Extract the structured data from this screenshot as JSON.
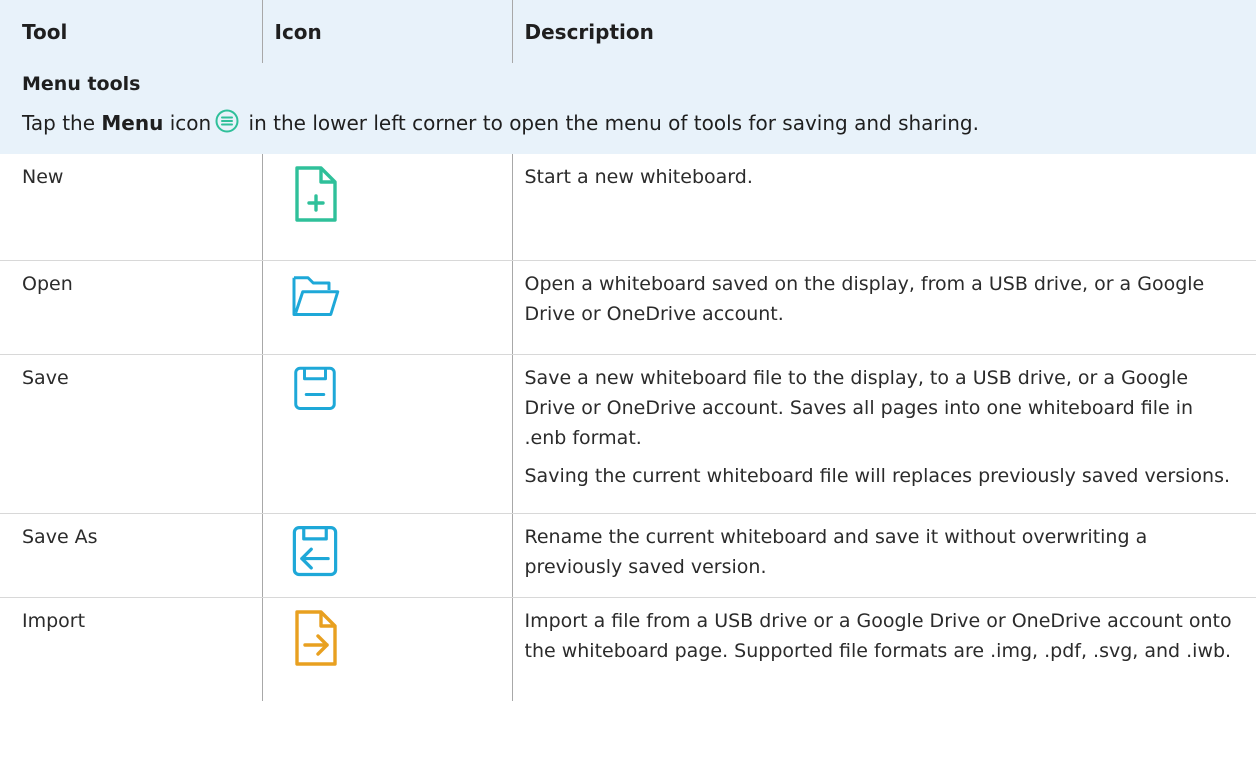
{
  "table": {
    "headers": {
      "tool": "Tool",
      "icon": "Icon",
      "description": "Description"
    },
    "section": {
      "title": "Menu tools",
      "intro_pre": "Tap the ",
      "intro_bold": "Menu",
      "intro_mid": " icon",
      "intro_post": " in the lower left corner to open the menu of tools for saving and sharing.",
      "menu_icon": "menu-circle-icon"
    },
    "rows": [
      {
        "tool": "New",
        "icon": "new-file-icon",
        "icon_color": "#2fc09a",
        "description": [
          "Start a new whiteboard."
        ]
      },
      {
        "tool": "Open",
        "icon": "open-folder-icon",
        "icon_color": "#1ea8d8",
        "description": [
          "Open a whiteboard saved on the display, from a USB drive, or a Google Drive or OneDrive account."
        ]
      },
      {
        "tool": "Save",
        "icon": "save-floppy-icon",
        "icon_color": "#1ea8d8",
        "description": [
          "Save a new whiteboard file to the display, to a USB drive, or a Google Drive or OneDrive account. Saves all pages into one whiteboard file in .enb format.",
          "Saving the current whiteboard file will replaces previously saved versions."
        ]
      },
      {
        "tool": "Save As",
        "icon": "save-as-floppy-icon",
        "icon_color": "#1ea8d8",
        "description": [
          "Rename the current whiteboard and save it without overwriting a previously saved version."
        ]
      },
      {
        "tool": "Import",
        "icon": "import-file-icon",
        "icon_color": "#e8a020",
        "description": [
          "Import a file from a USB drive or a Google Drive or OneDrive account onto the whiteboard page. Supported file formats are .img, .pdf, .svg, and .iwb."
        ]
      }
    ]
  },
  "colors": {
    "header_bg": "#e8f2fa",
    "text": "#2b2b2b",
    "divider": "#a8a8a8"
  }
}
